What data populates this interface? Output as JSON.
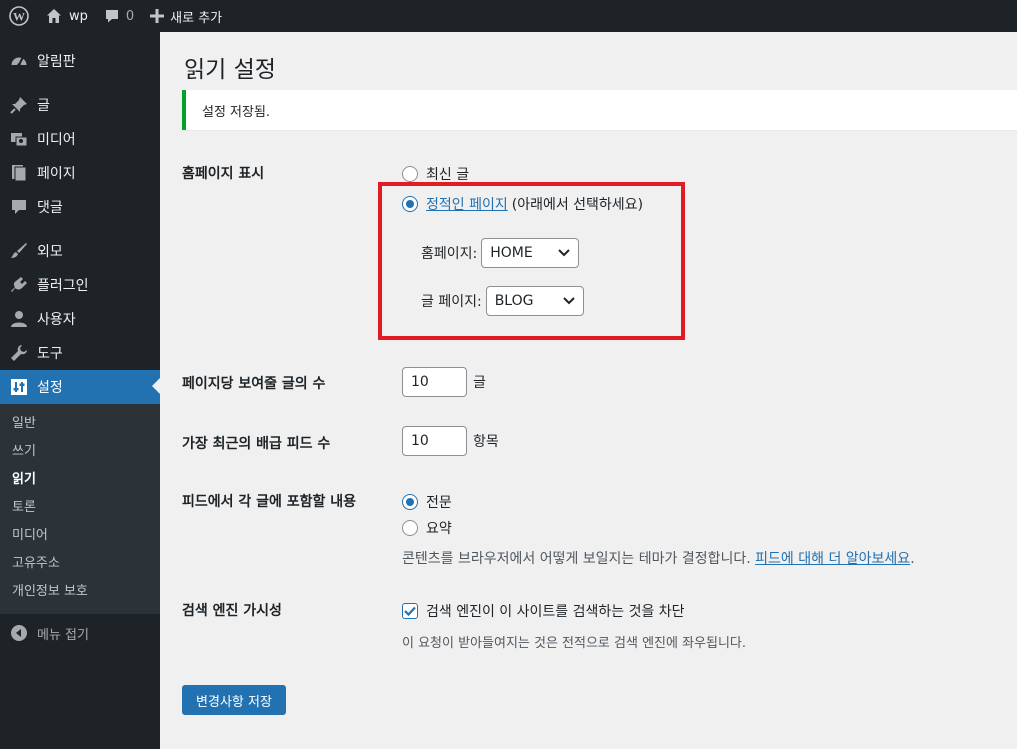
{
  "adminbar": {
    "site_name": "wp",
    "comments_count": "0",
    "new_label": "새로 추가"
  },
  "sidebar": {
    "items": [
      {
        "label": "알림판",
        "icon": "dashboard-icon"
      },
      {
        "label": "글",
        "icon": "pin-icon"
      },
      {
        "label": "미디어",
        "icon": "media-icon"
      },
      {
        "label": "페이지",
        "icon": "page-icon"
      },
      {
        "label": "댓글",
        "icon": "comment-icon"
      },
      {
        "label": "외모",
        "icon": "brush-icon"
      },
      {
        "label": "플러그인",
        "icon": "plugin-icon"
      },
      {
        "label": "사용자",
        "icon": "user-icon"
      },
      {
        "label": "도구",
        "icon": "wrench-icon"
      },
      {
        "label": "설정",
        "icon": "settings-icon"
      }
    ],
    "submenu": [
      "일반",
      "쓰기",
      "읽기",
      "토론",
      "미디어",
      "고유주소",
      "개인정보 보호"
    ],
    "collapse_label": "메뉴 접기"
  },
  "page": {
    "title": "읽기 설정",
    "notice": "설정 저장됨."
  },
  "homepage_display": {
    "label": "홈페이지 표시",
    "option_latest": "최신 글",
    "option_static_link": "정적인 페이지",
    "option_static_suffix": "(아래에서 선택하세요)",
    "homepage_label": "홈페이지:",
    "homepage_value": "HOME",
    "posts_page_label": "글 페이지:",
    "posts_page_value": "BLOG"
  },
  "posts_per_page": {
    "label": "페이지당 보여줄 글의 수",
    "value": "10",
    "unit": "글"
  },
  "feed_items": {
    "label": "가장 최근의 배급 피드 수",
    "value": "10",
    "unit": "항목"
  },
  "feed_content": {
    "label": "피드에서 각 글에 포함할 내용",
    "option_full": "전문",
    "option_summary": "요약",
    "desc_prefix": "콘텐츠를 브라우저에서 어떻게 보일지는 테마가 결정합니다.",
    "desc_link": "피드에 대해 더 알아보세요",
    "desc_suffix": "."
  },
  "search_visibility": {
    "label": "검색 엔진 가시성",
    "checkbox_label": "검색 엔진이 이 사이트를 검색하는 것을 차단",
    "desc": "이 요청이 받아들여지는 것은 전적으로 검색 엔진에 좌우됩니다."
  },
  "save_button": "변경사항 저장",
  "colors": {
    "accent": "#2271b1",
    "success": "#00a32a",
    "highlight": "#e01b24",
    "sidebar_bg": "#1d2327"
  }
}
